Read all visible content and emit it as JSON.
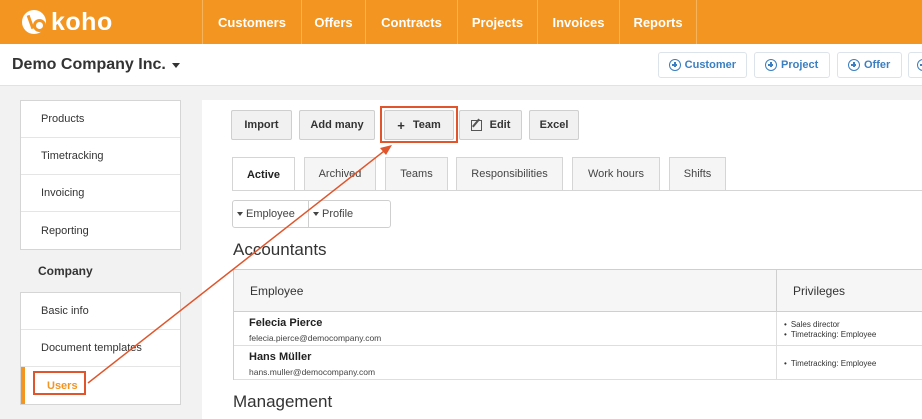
{
  "brand": {
    "name": "koho"
  },
  "nav": [
    "Customers",
    "Offers",
    "Contracts",
    "Projects",
    "Invoices",
    "Reports"
  ],
  "company": {
    "name": "Demo Company Inc."
  },
  "quick_actions": [
    "Customer",
    "Project",
    "Offer"
  ],
  "sidebar": {
    "group1": [
      "Products",
      "Timetracking",
      "Invoicing",
      "Reporting"
    ],
    "heading": "Company",
    "group2": [
      "Basic info",
      "Document templates",
      "Users"
    ]
  },
  "toolbar": {
    "import": "Import",
    "add_many": "Add many",
    "team": "Team",
    "edit": "Edit",
    "excel": "Excel"
  },
  "tabs": [
    "Active",
    "Archived",
    "Teams",
    "Responsibilities",
    "Work hours",
    "Shifts"
  ],
  "filters": [
    "Employee",
    "Profile"
  ],
  "sections": [
    "Accountants",
    "Management"
  ],
  "table": {
    "headers": {
      "employee": "Employee",
      "privileges": "Privileges"
    },
    "rows": [
      {
        "name": "Felecia Pierce",
        "email": "felecia.pierce@democompany.com",
        "privileges": [
          "Sales director",
          "Timetracking: Employee"
        ]
      },
      {
        "name": "Hans Müller",
        "email": "hans.muller@democompany.com",
        "privileges": [
          "Timetracking: Employee"
        ]
      }
    ]
  },
  "colors": {
    "brand": "#f39521",
    "annotation": "#e0552b",
    "link": "#3a7fc1"
  }
}
